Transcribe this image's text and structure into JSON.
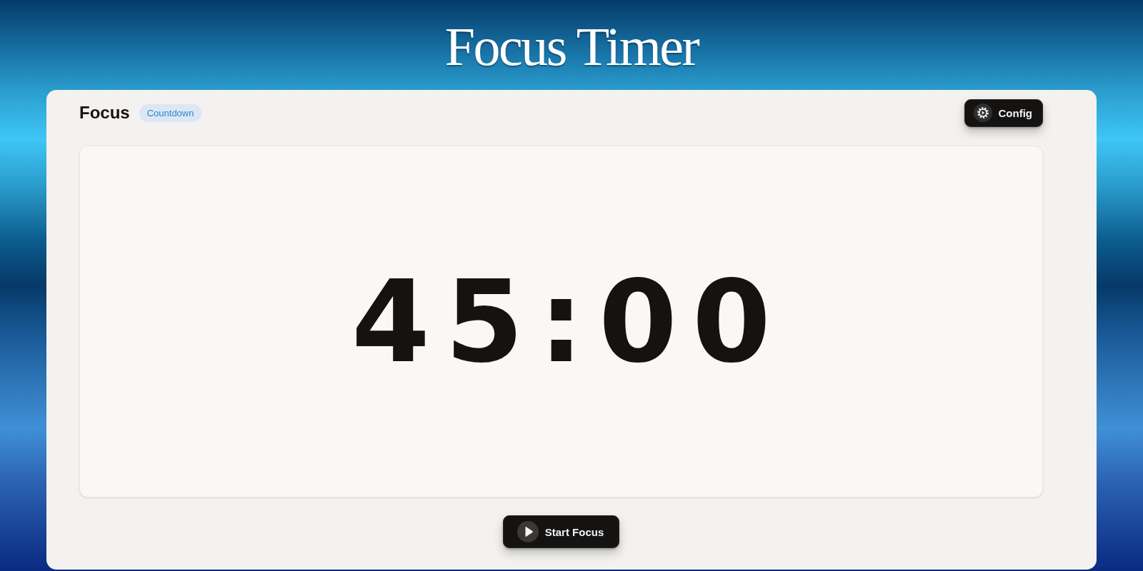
{
  "title": "Focus Timer",
  "mode": {
    "label": "Focus",
    "badge": "Countdown"
  },
  "config_button": {
    "label": "Config"
  },
  "timer": {
    "display": "45:00"
  },
  "start_button": {
    "label": "Start Focus"
  }
}
